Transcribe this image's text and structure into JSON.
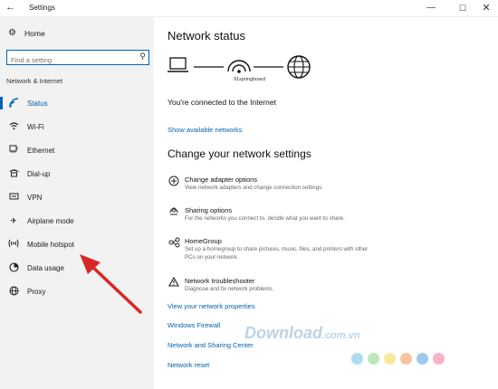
{
  "window": {
    "title": "Settings",
    "min": "—",
    "max": "☐",
    "close": "✕"
  },
  "sidebar": {
    "home_label": "Home",
    "search_placeholder": "Find a setting",
    "section_label": "Network & Internet",
    "items": [
      {
        "label": "Status",
        "icon": "status-icon",
        "active": true
      },
      {
        "label": "Wi-Fi",
        "icon": "wifi-icon"
      },
      {
        "label": "Ethernet",
        "icon": "ethernet-icon"
      },
      {
        "label": "Dial-up",
        "icon": "dialup-icon"
      },
      {
        "label": "VPN",
        "icon": "vpn-icon"
      },
      {
        "label": "Airplane mode",
        "icon": "airplane-icon"
      },
      {
        "label": "Mobile hotspot",
        "icon": "hotspot-icon"
      },
      {
        "label": "Data usage",
        "icon": "data-usage-icon"
      },
      {
        "label": "Proxy",
        "icon": "globe-icon"
      }
    ]
  },
  "main": {
    "network_status_title": "Network status",
    "network_name": "91springboard",
    "connected_text": "You're connected to the Internet",
    "show_networks_link": "Show available networks",
    "change_title": "Change your network settings",
    "options": [
      {
        "title": "Change adapter options",
        "desc": "View network adapters and change connection settings."
      },
      {
        "title": "Sharing options",
        "desc": "For the networks you connect to, decide what you want to share."
      },
      {
        "title": "HomeGroup",
        "desc": "Set up a homegroup to share pictures, music, files, and printers with other PCs on your network."
      },
      {
        "title": "Network troubleshooter",
        "desc": "Diagnose and fix network problems."
      }
    ],
    "links": [
      "View your network properties",
      "Windows Firewall",
      "Network and Sharing Center",
      "Network reset"
    ]
  },
  "watermark": {
    "text": "Download",
    "suffix": ".com.vn"
  },
  "colors": {
    "accent": "#0063b1",
    "arrow": "#d92626",
    "sidebar_bg": "#f2f2f2"
  },
  "dot_colors": [
    "#8fd0f0",
    "#a6e0a6",
    "#f6e07a",
    "#f6b07a",
    "#7ab8e8",
    "#f59ab0"
  ]
}
